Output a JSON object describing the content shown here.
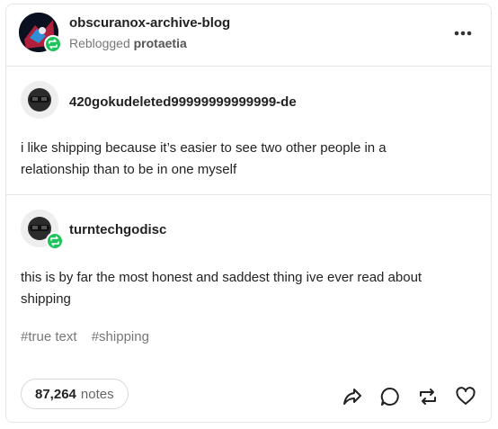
{
  "post": {
    "blog_name": "obscuranox-archive-blog",
    "reblogged_label": "Reblogged",
    "reblog_source": "protaetia"
  },
  "trail": [
    {
      "username": "420gokudeleted99999999999999-de",
      "text": "i like shipping because it’s easier to see two other people in a relationship than to be in one myself"
    },
    {
      "username": "turntechgodisc",
      "text": "this is by far the most honest and saddest thing ive ever read about shipping"
    }
  ],
  "tags": [
    "#true text",
    "#shipping"
  ],
  "footer": {
    "notes_count": "87,264",
    "notes_label": "notes"
  },
  "icons": {
    "more": "more-options-icon",
    "share": "share-icon",
    "reply": "reply-icon",
    "reblog": "reblog-icon",
    "like": "heart-icon"
  },
  "colors": {
    "reblog_badge": "#1fc35b",
    "border": "#e6e6e6",
    "muted_text": "#777777"
  }
}
